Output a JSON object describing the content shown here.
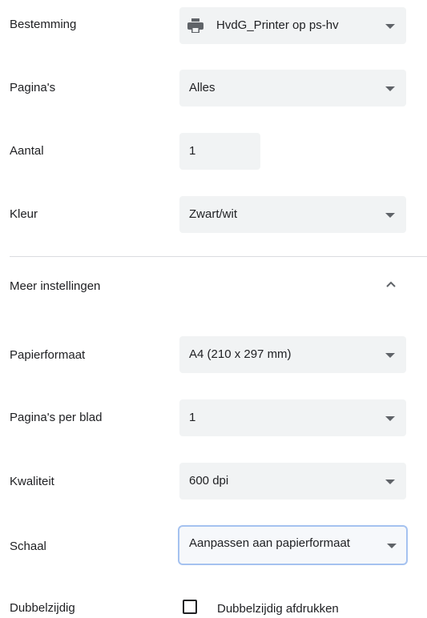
{
  "destination": {
    "label": "Bestemming",
    "value": "HvdG_Printer op ps-hv",
    "icon": "printer-icon"
  },
  "pages": {
    "label": "Pagina's",
    "value": "Alles"
  },
  "copies": {
    "label": "Aantal",
    "value": "1"
  },
  "color": {
    "label": "Kleur",
    "value": "Zwart/wit"
  },
  "more_settings": {
    "label": "Meer instellingen",
    "icon": "chevron-up-icon"
  },
  "paper_size": {
    "label": "Papierformaat",
    "value": "A4 (210 x 297 mm)"
  },
  "pages_per_sheet": {
    "label": "Pagina's per blad",
    "value": "1"
  },
  "quality": {
    "label": "Kwaliteit",
    "value": "600 dpi"
  },
  "scale": {
    "label": "Schaal",
    "value": "Aanpassen aan papierformaat"
  },
  "duplex": {
    "label": "Dubbelzijdig",
    "checkbox_label": "Dubbelzijdig afdrukken",
    "checked": false
  }
}
